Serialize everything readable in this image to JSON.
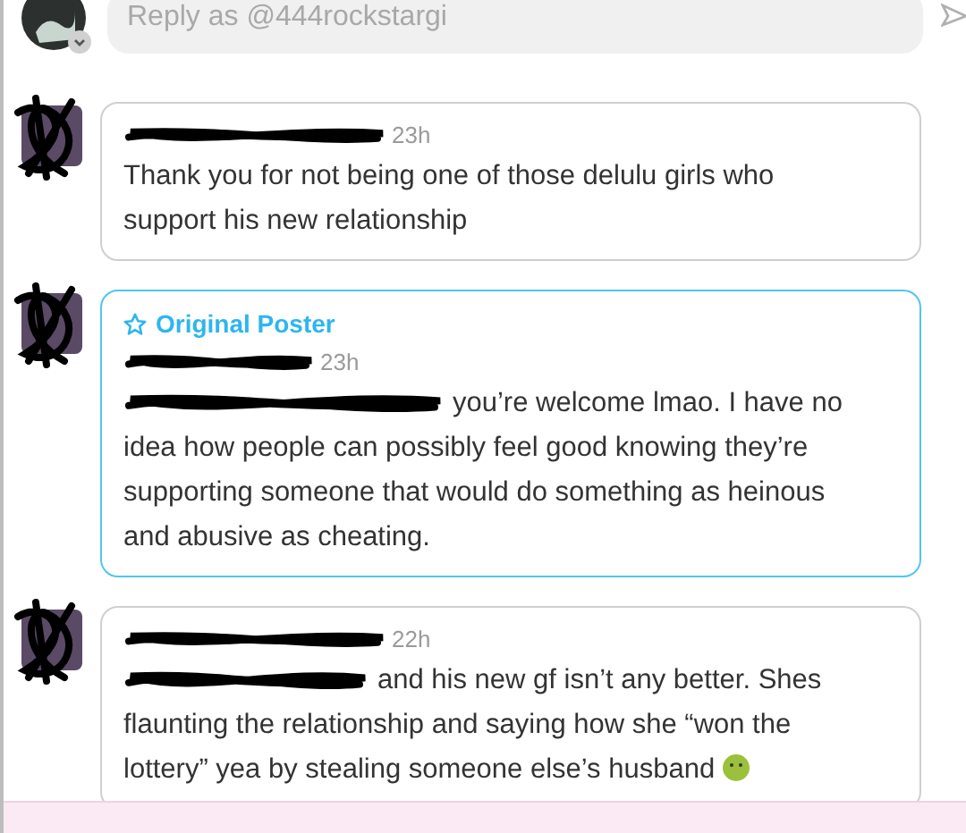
{
  "reply_field": {
    "placeholder": "Reply as @444rockstargi"
  },
  "replies": [
    {
      "original_poster": false,
      "time": "23h",
      "mention_redacted": false,
      "text": "Thank you for not being one of those delulu girls who support his new relationship",
      "emoji": false
    },
    {
      "original_poster": true,
      "badge": "Original Poster",
      "time": "23h",
      "mention_redacted": true,
      "text": "you’re welcome lmao. I have no idea how people can possibly feel good knowing they’re supporting someone that would do something as heinous and abusive as cheating.",
      "emoji": false
    },
    {
      "original_poster": false,
      "time": "22h",
      "mention_redacted": true,
      "text": "and his new gf isn’t any better. Shes flaunting the relationship and saying how she “won the lottery” yea by stealing someone else’s husband",
      "emoji": true
    }
  ]
}
